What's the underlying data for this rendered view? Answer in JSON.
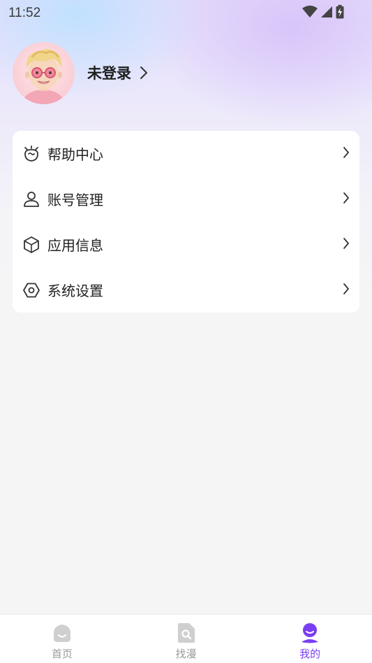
{
  "status_bar": {
    "time": "11:52",
    "icons": [
      "wifi-icon",
      "cellular-signal-icon",
      "battery-charging-icon"
    ]
  },
  "profile": {
    "login_label": "未登录"
  },
  "menu": {
    "items": [
      {
        "icon": "help-robot-icon",
        "label": "帮助中心"
      },
      {
        "icon": "user-account-icon",
        "label": "账号管理"
      },
      {
        "icon": "cube-info-icon",
        "label": "应用信息"
      },
      {
        "icon": "settings-hexagon-icon",
        "label": "系统设置"
      }
    ]
  },
  "bottom_nav": {
    "items": [
      {
        "icon": "home-icon",
        "label": "首页",
        "active": false
      },
      {
        "icon": "search-doc-icon",
        "label": "找漫",
        "active": false
      },
      {
        "icon": "profile-icon",
        "label": "我的",
        "active": true
      }
    ]
  },
  "colors": {
    "accent": "#7b3ff2",
    "inactive": "#c4c4c4",
    "text": "#222222"
  }
}
